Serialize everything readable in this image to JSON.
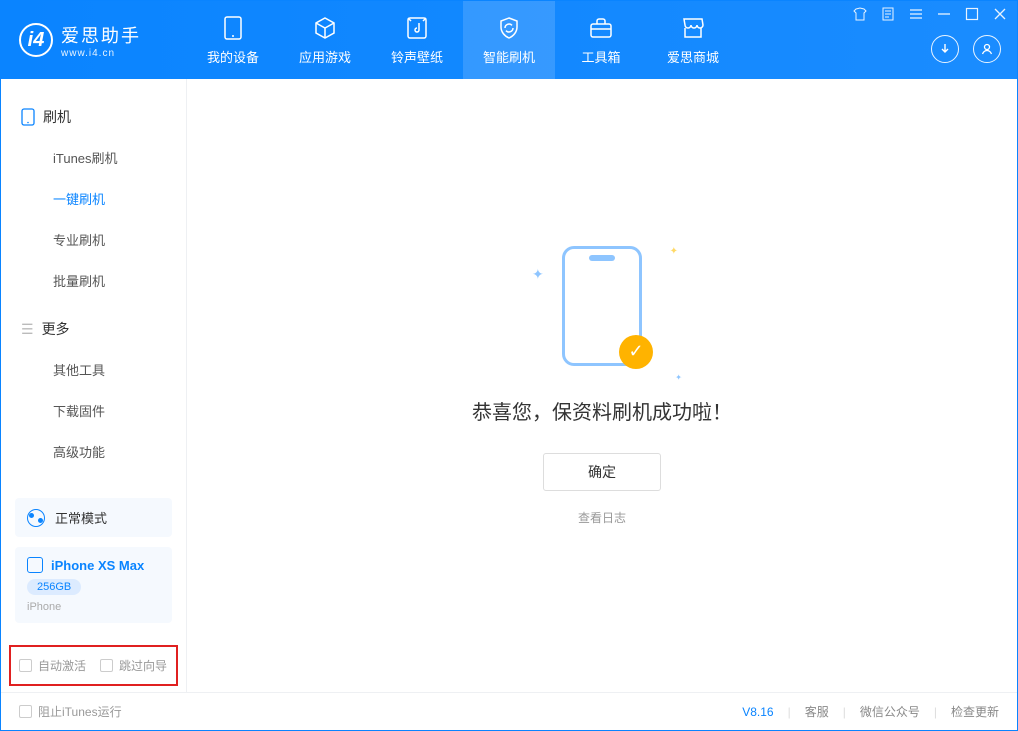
{
  "app": {
    "title": "爱思助手",
    "subtitle": "www.i4.cn"
  },
  "nav": {
    "items": [
      {
        "label": "我的设备"
      },
      {
        "label": "应用游戏"
      },
      {
        "label": "铃声壁纸"
      },
      {
        "label": "智能刷机"
      },
      {
        "label": "工具箱"
      },
      {
        "label": "爱思商城"
      }
    ]
  },
  "sidebar": {
    "group1": {
      "title": "刷机",
      "items": [
        {
          "label": "iTunes刷机"
        },
        {
          "label": "一键刷机"
        },
        {
          "label": "专业刷机"
        },
        {
          "label": "批量刷机"
        }
      ]
    },
    "group2": {
      "title": "更多",
      "items": [
        {
          "label": "其他工具"
        },
        {
          "label": "下载固件"
        },
        {
          "label": "高级功能"
        }
      ]
    },
    "mode": "正常模式",
    "device": {
      "name": "iPhone XS Max",
      "storage": "256GB",
      "type": "iPhone"
    },
    "options": {
      "auto_activate": "自动激活",
      "skip_guide": "跳过向导"
    }
  },
  "main": {
    "success_text": "恭喜您，保资料刷机成功啦！",
    "ok_label": "确定",
    "log_link": "查看日志"
  },
  "footer": {
    "block_itunes": "阻止iTunes运行",
    "version": "V8.16",
    "links": {
      "support": "客服",
      "wechat": "微信公众号",
      "update": "检查更新"
    }
  }
}
